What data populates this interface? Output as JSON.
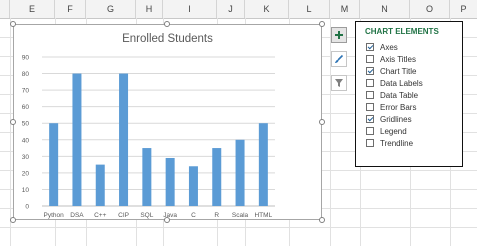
{
  "columns": [
    "E",
    "F",
    "G",
    "H",
    "I",
    "J",
    "K",
    "L",
    "M",
    "N",
    "O",
    "P"
  ],
  "chart": {
    "title": "Enrolled Students"
  },
  "chart_data": {
    "type": "bar",
    "title": "Enrolled Students",
    "categories": [
      "Python",
      "DSA",
      "C++",
      "CIP",
      "SQL",
      "Java",
      "C",
      "R",
      "Scala",
      "HTML"
    ],
    "values": [
      50,
      80,
      25,
      80,
      35,
      29,
      24,
      35,
      40,
      50
    ],
    "ylim": [
      0,
      90
    ],
    "yticks": [
      "0",
      "10",
      "20",
      "30",
      "40",
      "50",
      "60",
      "70",
      "80",
      "90"
    ],
    "grid": true,
    "bar_color": "#5b9bd5"
  },
  "side_buttons": [
    {
      "name": "chart-elements-button",
      "icon": "plus-icon"
    },
    {
      "name": "chart-styles-button",
      "icon": "brush-icon"
    },
    {
      "name": "chart-filters-button",
      "icon": "filter-icon"
    }
  ],
  "panel": {
    "title": "CHART ELEMENTS",
    "items": [
      {
        "label": "Axes",
        "checked": true
      },
      {
        "label": "Axis Titles",
        "checked": false
      },
      {
        "label": "Chart Title",
        "checked": true
      },
      {
        "label": "Data Labels",
        "checked": false
      },
      {
        "label": "Data Table",
        "checked": false
      },
      {
        "label": "Error Bars",
        "checked": false
      },
      {
        "label": "Gridlines",
        "checked": true
      },
      {
        "label": "Legend",
        "checked": false
      },
      {
        "label": "Trendline",
        "checked": false
      }
    ]
  },
  "colors": {
    "accent": "#217346",
    "bar": "#5b9bd5"
  }
}
